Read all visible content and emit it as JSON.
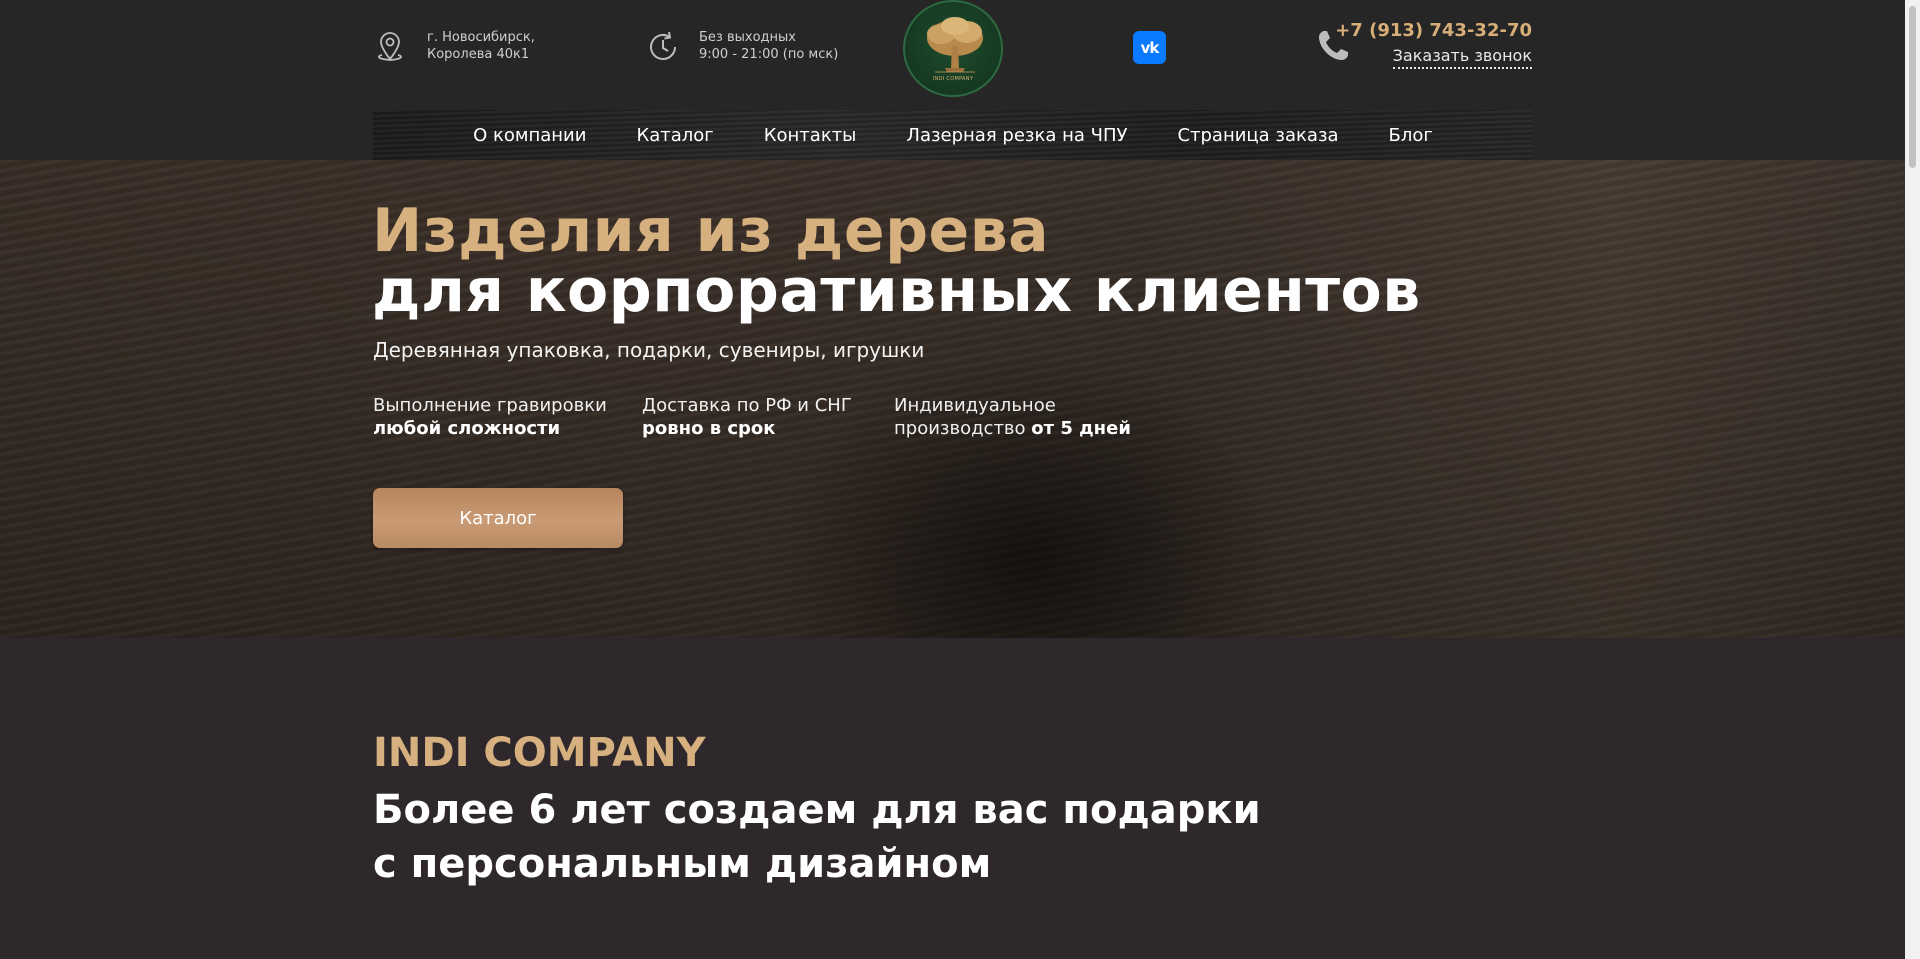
{
  "header": {
    "location": {
      "line1": "г. Новосибирск,",
      "line2": "Королева 40к1",
      "icon": "map-pin-icon"
    },
    "hours": {
      "line1": "Без выходных",
      "line2": "9:00 - 21:00 (по мск)",
      "icon": "clock-icon"
    },
    "logo": {
      "caption": "INDI COMPANY"
    },
    "vk": {
      "label": "vk"
    },
    "phone": {
      "number": "+7 (913) 743-32-70",
      "callback_label": "Заказать звонок",
      "icon": "phone-icon"
    }
  },
  "nav": {
    "items": [
      {
        "label": "О компании"
      },
      {
        "label": "Каталог"
      },
      {
        "label": "Контакты"
      },
      {
        "label": "Лазерная резка на ЧПУ"
      },
      {
        "label": "Страница заказа"
      },
      {
        "label": "Блог"
      }
    ]
  },
  "hero": {
    "title_line1": "Изделия из дерева",
    "title_line2": "для корпоративных клиентов",
    "subtitle": "Деревянная упаковка, подарки, сувениры, игрушки",
    "features": [
      {
        "normal": "Выполнение гравировки",
        "bold": "любой сложности"
      },
      {
        "normal": "Доставка по РФ и СНГ",
        "bold": "ровно в срок"
      },
      {
        "normal_line1": "Индивидуальное",
        "normal_line2": "производство",
        "bold": "от 5 дней"
      }
    ],
    "button_label": "Каталог"
  },
  "about": {
    "label": "INDI COMPANY",
    "heading_line1": "Более 6 лет создаем для вас подарки",
    "heading_line2": "с персональным дизайном"
  },
  "colors": {
    "accent_gold": "#d6b07e",
    "phone_gold": "#d8ae78",
    "vk_blue": "#0a7bff",
    "page_background": "#2e282c",
    "header_background": "#262626"
  }
}
